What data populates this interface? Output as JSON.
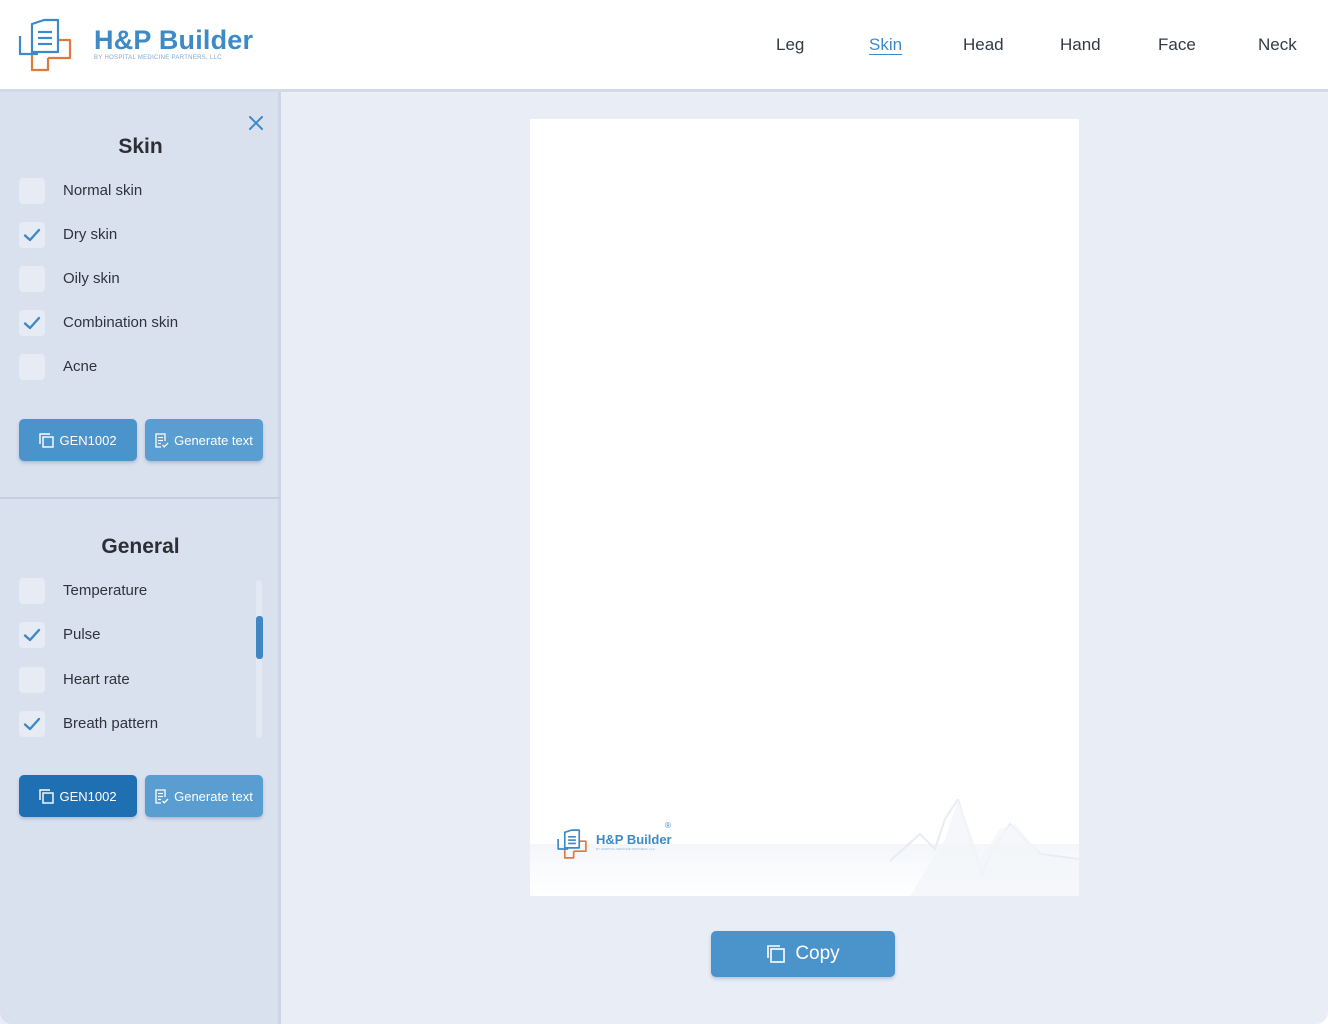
{
  "app": {
    "brand_title": "H&P Builder",
    "brand_subtitle": "BY HOSPITAL MEDICINE PARTNERS, LLC",
    "accent_color": "#3e8ac6",
    "logo_accent_color": "#e07a3a"
  },
  "nav": {
    "active": "Skin",
    "items": [
      {
        "label": "Leg"
      },
      {
        "label": "Skin"
      },
      {
        "label": "Head"
      },
      {
        "label": "Hand"
      },
      {
        "label": "Face"
      },
      {
        "label": "Neck"
      }
    ]
  },
  "sidebar": {
    "close_icon": "close-icon",
    "skin": {
      "title": "Skin",
      "items": [
        {
          "label": "Normal skin",
          "checked": false
        },
        {
          "label": "Dry skin",
          "checked": true
        },
        {
          "label": "Oily skin",
          "checked": false
        },
        {
          "label": "Combination skin",
          "checked": true
        },
        {
          "label": "Acne",
          "checked": false
        }
      ],
      "code_button": "GEN1002",
      "generate_button": "Generate text"
    },
    "general": {
      "title": "General",
      "items": [
        {
          "label": "Temperature",
          "checked": false
        },
        {
          "label": "Pulse",
          "checked": true
        },
        {
          "label": "Heart rate",
          "checked": false
        },
        {
          "label": "Breath pattern",
          "checked": true
        }
      ],
      "code_button": "GEN1002",
      "generate_button": "Generate text"
    }
  },
  "document": {
    "brand_title": "H&P Builder",
    "brand_subtitle": "BY HOSPITAL MEDICINE PARTNERS, LLC",
    "registered_mark": "®"
  },
  "copy_button": "Copy"
}
